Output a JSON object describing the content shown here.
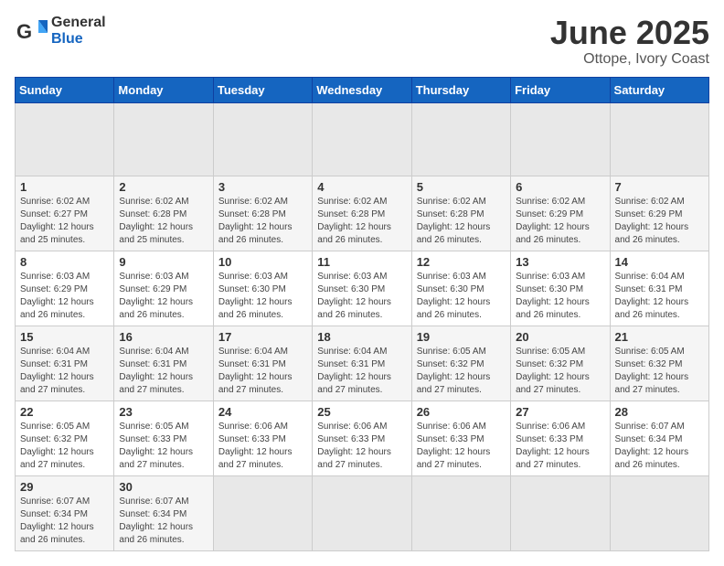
{
  "header": {
    "logo_general": "General",
    "logo_blue": "Blue",
    "title": "June 2025",
    "subtitle": "Ottope, Ivory Coast"
  },
  "calendar": {
    "days_of_week": [
      "Sunday",
      "Monday",
      "Tuesday",
      "Wednesday",
      "Thursday",
      "Friday",
      "Saturday"
    ],
    "weeks": [
      [
        {
          "day": "",
          "empty": true
        },
        {
          "day": "",
          "empty": true
        },
        {
          "day": "",
          "empty": true
        },
        {
          "day": "",
          "empty": true
        },
        {
          "day": "",
          "empty": true
        },
        {
          "day": "",
          "empty": true
        },
        {
          "day": "",
          "empty": true
        }
      ],
      [
        {
          "day": "1",
          "sunrise": "6:02 AM",
          "sunset": "6:27 PM",
          "daylight": "12 hours and 25 minutes."
        },
        {
          "day": "2",
          "sunrise": "6:02 AM",
          "sunset": "6:28 PM",
          "daylight": "12 hours and 25 minutes."
        },
        {
          "day": "3",
          "sunrise": "6:02 AM",
          "sunset": "6:28 PM",
          "daylight": "12 hours and 26 minutes."
        },
        {
          "day": "4",
          "sunrise": "6:02 AM",
          "sunset": "6:28 PM",
          "daylight": "12 hours and 26 minutes."
        },
        {
          "day": "5",
          "sunrise": "6:02 AM",
          "sunset": "6:28 PM",
          "daylight": "12 hours and 26 minutes."
        },
        {
          "day": "6",
          "sunrise": "6:02 AM",
          "sunset": "6:29 PM",
          "daylight": "12 hours and 26 minutes."
        },
        {
          "day": "7",
          "sunrise": "6:02 AM",
          "sunset": "6:29 PM",
          "daylight": "12 hours and 26 minutes."
        }
      ],
      [
        {
          "day": "8",
          "sunrise": "6:03 AM",
          "sunset": "6:29 PM",
          "daylight": "12 hours and 26 minutes."
        },
        {
          "day": "9",
          "sunrise": "6:03 AM",
          "sunset": "6:29 PM",
          "daylight": "12 hours and 26 minutes."
        },
        {
          "day": "10",
          "sunrise": "6:03 AM",
          "sunset": "6:30 PM",
          "daylight": "12 hours and 26 minutes."
        },
        {
          "day": "11",
          "sunrise": "6:03 AM",
          "sunset": "6:30 PM",
          "daylight": "12 hours and 26 minutes."
        },
        {
          "day": "12",
          "sunrise": "6:03 AM",
          "sunset": "6:30 PM",
          "daylight": "12 hours and 26 minutes."
        },
        {
          "day": "13",
          "sunrise": "6:03 AM",
          "sunset": "6:30 PM",
          "daylight": "12 hours and 26 minutes."
        },
        {
          "day": "14",
          "sunrise": "6:04 AM",
          "sunset": "6:31 PM",
          "daylight": "12 hours and 26 minutes."
        }
      ],
      [
        {
          "day": "15",
          "sunrise": "6:04 AM",
          "sunset": "6:31 PM",
          "daylight": "12 hours and 27 minutes."
        },
        {
          "day": "16",
          "sunrise": "6:04 AM",
          "sunset": "6:31 PM",
          "daylight": "12 hours and 27 minutes."
        },
        {
          "day": "17",
          "sunrise": "6:04 AM",
          "sunset": "6:31 PM",
          "daylight": "12 hours and 27 minutes."
        },
        {
          "day": "18",
          "sunrise": "6:04 AM",
          "sunset": "6:31 PM",
          "daylight": "12 hours and 27 minutes."
        },
        {
          "day": "19",
          "sunrise": "6:05 AM",
          "sunset": "6:32 PM",
          "daylight": "12 hours and 27 minutes."
        },
        {
          "day": "20",
          "sunrise": "6:05 AM",
          "sunset": "6:32 PM",
          "daylight": "12 hours and 27 minutes."
        },
        {
          "day": "21",
          "sunrise": "6:05 AM",
          "sunset": "6:32 PM",
          "daylight": "12 hours and 27 minutes."
        }
      ],
      [
        {
          "day": "22",
          "sunrise": "6:05 AM",
          "sunset": "6:32 PM",
          "daylight": "12 hours and 27 minutes."
        },
        {
          "day": "23",
          "sunrise": "6:05 AM",
          "sunset": "6:33 PM",
          "daylight": "12 hours and 27 minutes."
        },
        {
          "day": "24",
          "sunrise": "6:06 AM",
          "sunset": "6:33 PM",
          "daylight": "12 hours and 27 minutes."
        },
        {
          "day": "25",
          "sunrise": "6:06 AM",
          "sunset": "6:33 PM",
          "daylight": "12 hours and 27 minutes."
        },
        {
          "day": "26",
          "sunrise": "6:06 AM",
          "sunset": "6:33 PM",
          "daylight": "12 hours and 27 minutes."
        },
        {
          "day": "27",
          "sunrise": "6:06 AM",
          "sunset": "6:33 PM",
          "daylight": "12 hours and 27 minutes."
        },
        {
          "day": "28",
          "sunrise": "6:07 AM",
          "sunset": "6:34 PM",
          "daylight": "12 hours and 26 minutes."
        }
      ],
      [
        {
          "day": "29",
          "sunrise": "6:07 AM",
          "sunset": "6:34 PM",
          "daylight": "12 hours and 26 minutes."
        },
        {
          "day": "30",
          "sunrise": "6:07 AM",
          "sunset": "6:34 PM",
          "daylight": "12 hours and 26 minutes."
        },
        {
          "day": "",
          "empty": true
        },
        {
          "day": "",
          "empty": true
        },
        {
          "day": "",
          "empty": true
        },
        {
          "day": "",
          "empty": true
        },
        {
          "day": "",
          "empty": true
        }
      ]
    ]
  }
}
